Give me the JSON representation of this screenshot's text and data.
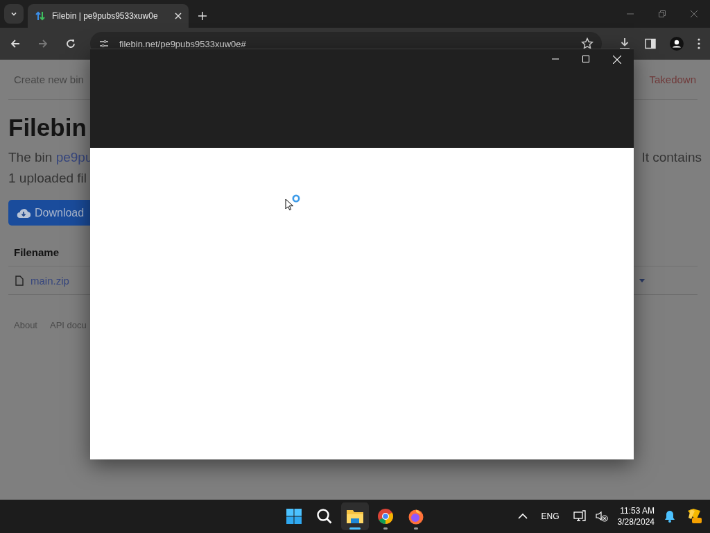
{
  "browser": {
    "tabs": [
      {
        "title": "Filebin | pe9pubs9533xuw0e",
        "selected": true
      }
    ],
    "address": "filebin.net/pe9pubs9533xuw0e#"
  },
  "page": {
    "nav_left": "Create new bin",
    "nav_right": "Takedown",
    "heading": "Filebin",
    "intro_start": "The bin",
    "bin_link": "pe9pu",
    "intro_end": "It contains",
    "intro_line2": "1 uploaded fil",
    "download_button": "Download",
    "table": {
      "columns": [
        "Filename"
      ],
      "rows": [
        {
          "name": "main.zip"
        }
      ]
    },
    "footer_links": [
      "About",
      "API docu"
    ]
  },
  "dialog": {
    "loading": true
  },
  "taskbar": {
    "apps": [
      {
        "kind": "start",
        "selected": false
      },
      {
        "kind": "search",
        "selected": false
      },
      {
        "kind": "files",
        "selected": true
      },
      {
        "kind": "chrome",
        "selected": false
      },
      {
        "kind": "firefox",
        "selected": false
      }
    ],
    "language": "ENG",
    "time": "11:53 AM",
    "date": "3/28/2024"
  }
}
